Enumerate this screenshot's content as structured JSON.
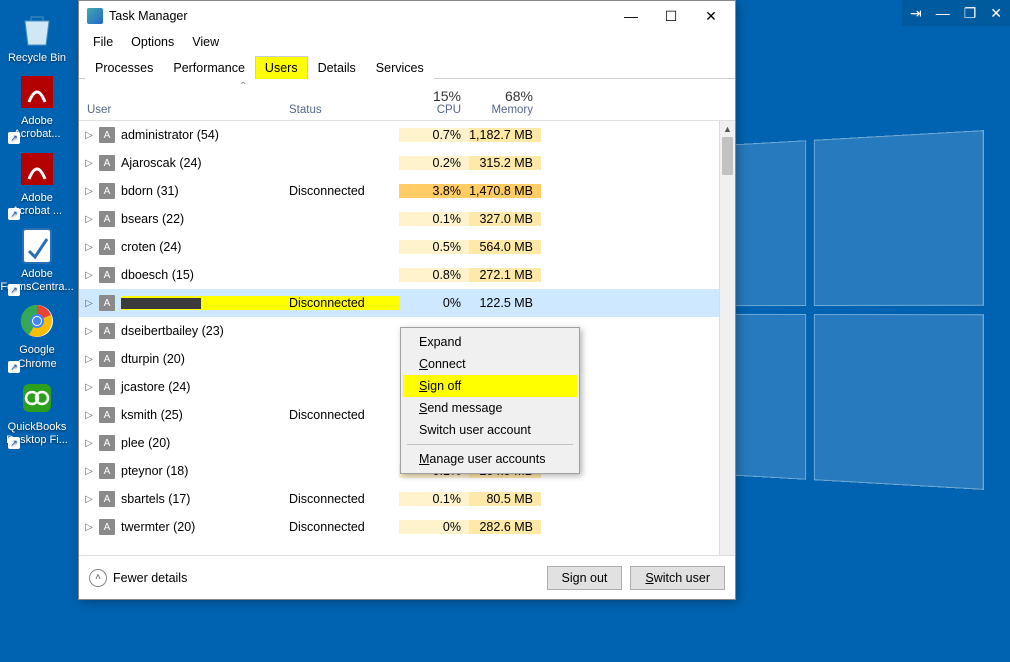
{
  "top_taskbar": {
    "pin": "⇥",
    "min": "—",
    "max": "❐",
    "close": "✕"
  },
  "desktop": {
    "icons": [
      {
        "label": "Recycle Bin"
      },
      {
        "label": "Adobe Acrobat..."
      },
      {
        "label": "Adobe Acrobat ..."
      },
      {
        "label": "Adobe FormsCentra..."
      },
      {
        "label": "Google Chrome"
      },
      {
        "label": "QuickBooks Desktop Fi..."
      }
    ]
  },
  "tm": {
    "title": "Task Manager",
    "menu": {
      "file": "File",
      "options": "Options",
      "view": "View"
    },
    "tabs": [
      "Processes",
      "Performance",
      "Users",
      "Details",
      "Services"
    ],
    "active_tab": 2,
    "headers": {
      "user": "User",
      "status": "Status",
      "cpu_pct": "15%",
      "cpu_label": "CPU",
      "mem_pct": "68%",
      "mem_label": "Memory",
      "sort_arrow": "⌃"
    },
    "rows": [
      {
        "name": "administrator (54)",
        "status": "",
        "cpu": "0.7%",
        "mem": "1,182.7 MB"
      },
      {
        "name": "Ajaroscak (24)",
        "status": "",
        "cpu": "0.2%",
        "mem": "315.2 MB"
      },
      {
        "name": "bdorn (31)",
        "status": "Disconnected",
        "cpu": "3.8%",
        "mem": "1,470.8 MB",
        "hot": true
      },
      {
        "name": "bsears (22)",
        "status": "",
        "cpu": "0.1%",
        "mem": "327.0 MB"
      },
      {
        "name": "croten (24)",
        "status": "",
        "cpu": "0.5%",
        "mem": "564.0 MB"
      },
      {
        "name": "dboesch (15)",
        "status": "",
        "cpu": "0.8%",
        "mem": "272.1 MB"
      },
      {
        "name": "",
        "status": "Disconnected",
        "cpu": "0%",
        "mem": "122.5 MB",
        "selected": true,
        "redacted": true
      },
      {
        "name": "dseibertbailey (23)",
        "status": "",
        "cpu": "",
        "mem": ""
      },
      {
        "name": "dturpin (20)",
        "status": "",
        "cpu": "",
        "mem": ""
      },
      {
        "name": "jcastore (24)",
        "status": "",
        "cpu": "",
        "mem": ""
      },
      {
        "name": "ksmith (25)",
        "status": "Disconnected",
        "cpu": "",
        "mem": ""
      },
      {
        "name": "plee (20)",
        "status": "",
        "cpu": "",
        "mem": ""
      },
      {
        "name": "pteynor (18)",
        "status": "",
        "cpu": "0.1%",
        "mem": "204.9 MB"
      },
      {
        "name": "sbartels (17)",
        "status": "Disconnected",
        "cpu": "0.1%",
        "mem": "80.5 MB"
      },
      {
        "name": "twermter (20)",
        "status": "Disconnected",
        "cpu": "0%",
        "mem": "282.6 MB"
      }
    ],
    "footer": {
      "fewer": "Fewer details",
      "signout": "Sign out",
      "switch": "Switch user"
    }
  },
  "context_menu": {
    "items": [
      {
        "label": "Expand",
        "accel": null
      },
      {
        "label": "Connect",
        "accel": "C"
      },
      {
        "label": "Sign off",
        "accel": "S",
        "highlight": true
      },
      {
        "label": "Send message",
        "accel": "S"
      },
      {
        "label": "Switch user account",
        "accel": null
      },
      {
        "sep": true
      },
      {
        "label": "Manage user accounts",
        "accel": "M"
      }
    ]
  }
}
